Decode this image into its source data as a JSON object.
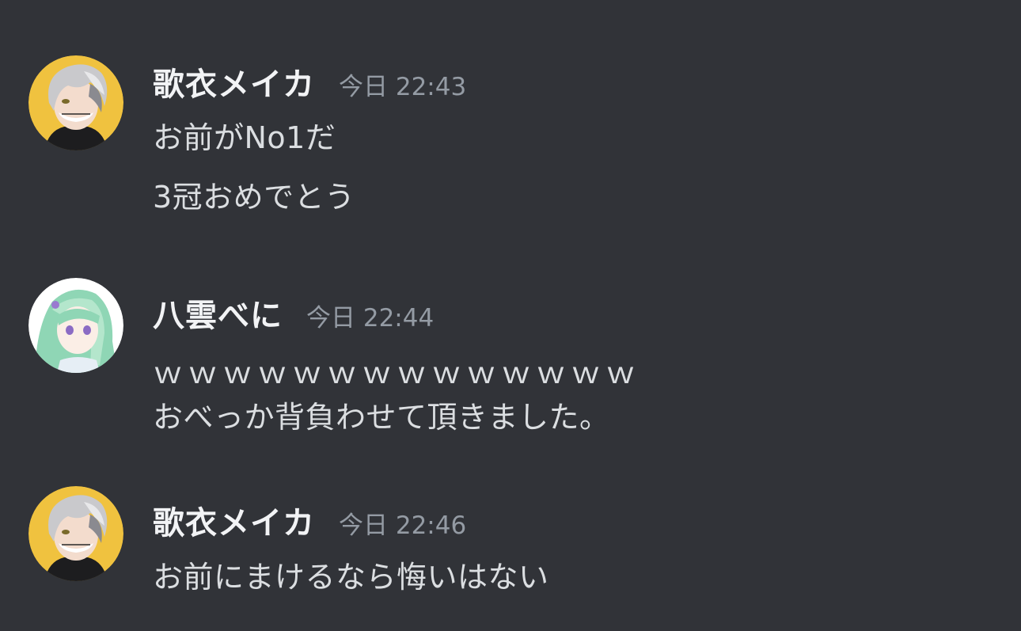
{
  "messages": [
    {
      "author": "歌衣メイカ",
      "timestamp": "今日 22:43",
      "avatar_icon": "gray-hair-character-avatar-icon",
      "lines": [
        "お前がNo1だ",
        "3冠おめでとう"
      ]
    },
    {
      "author": "八雲べに",
      "timestamp": "今日 22:44",
      "avatar_icon": "green-hair-character-avatar-icon",
      "lines": [
        "ｗｗｗｗｗｗｗｗｗｗｗｗｗｗ",
        "おべっか背負わせて頂きました。"
      ]
    },
    {
      "author": "歌衣メイカ",
      "timestamp": "今日 22:46",
      "avatar_icon": "gray-hair-character-avatar-icon",
      "lines": [
        "お前にまけるなら悔いはない"
      ]
    }
  ],
  "colors": {
    "background": "#313338",
    "username": "#f2f3f5",
    "timestamp": "#949ba4",
    "message_text": "#dbdee1",
    "avatar1_bg": "#f0c23f",
    "avatar2_bg": "#ffffff"
  }
}
